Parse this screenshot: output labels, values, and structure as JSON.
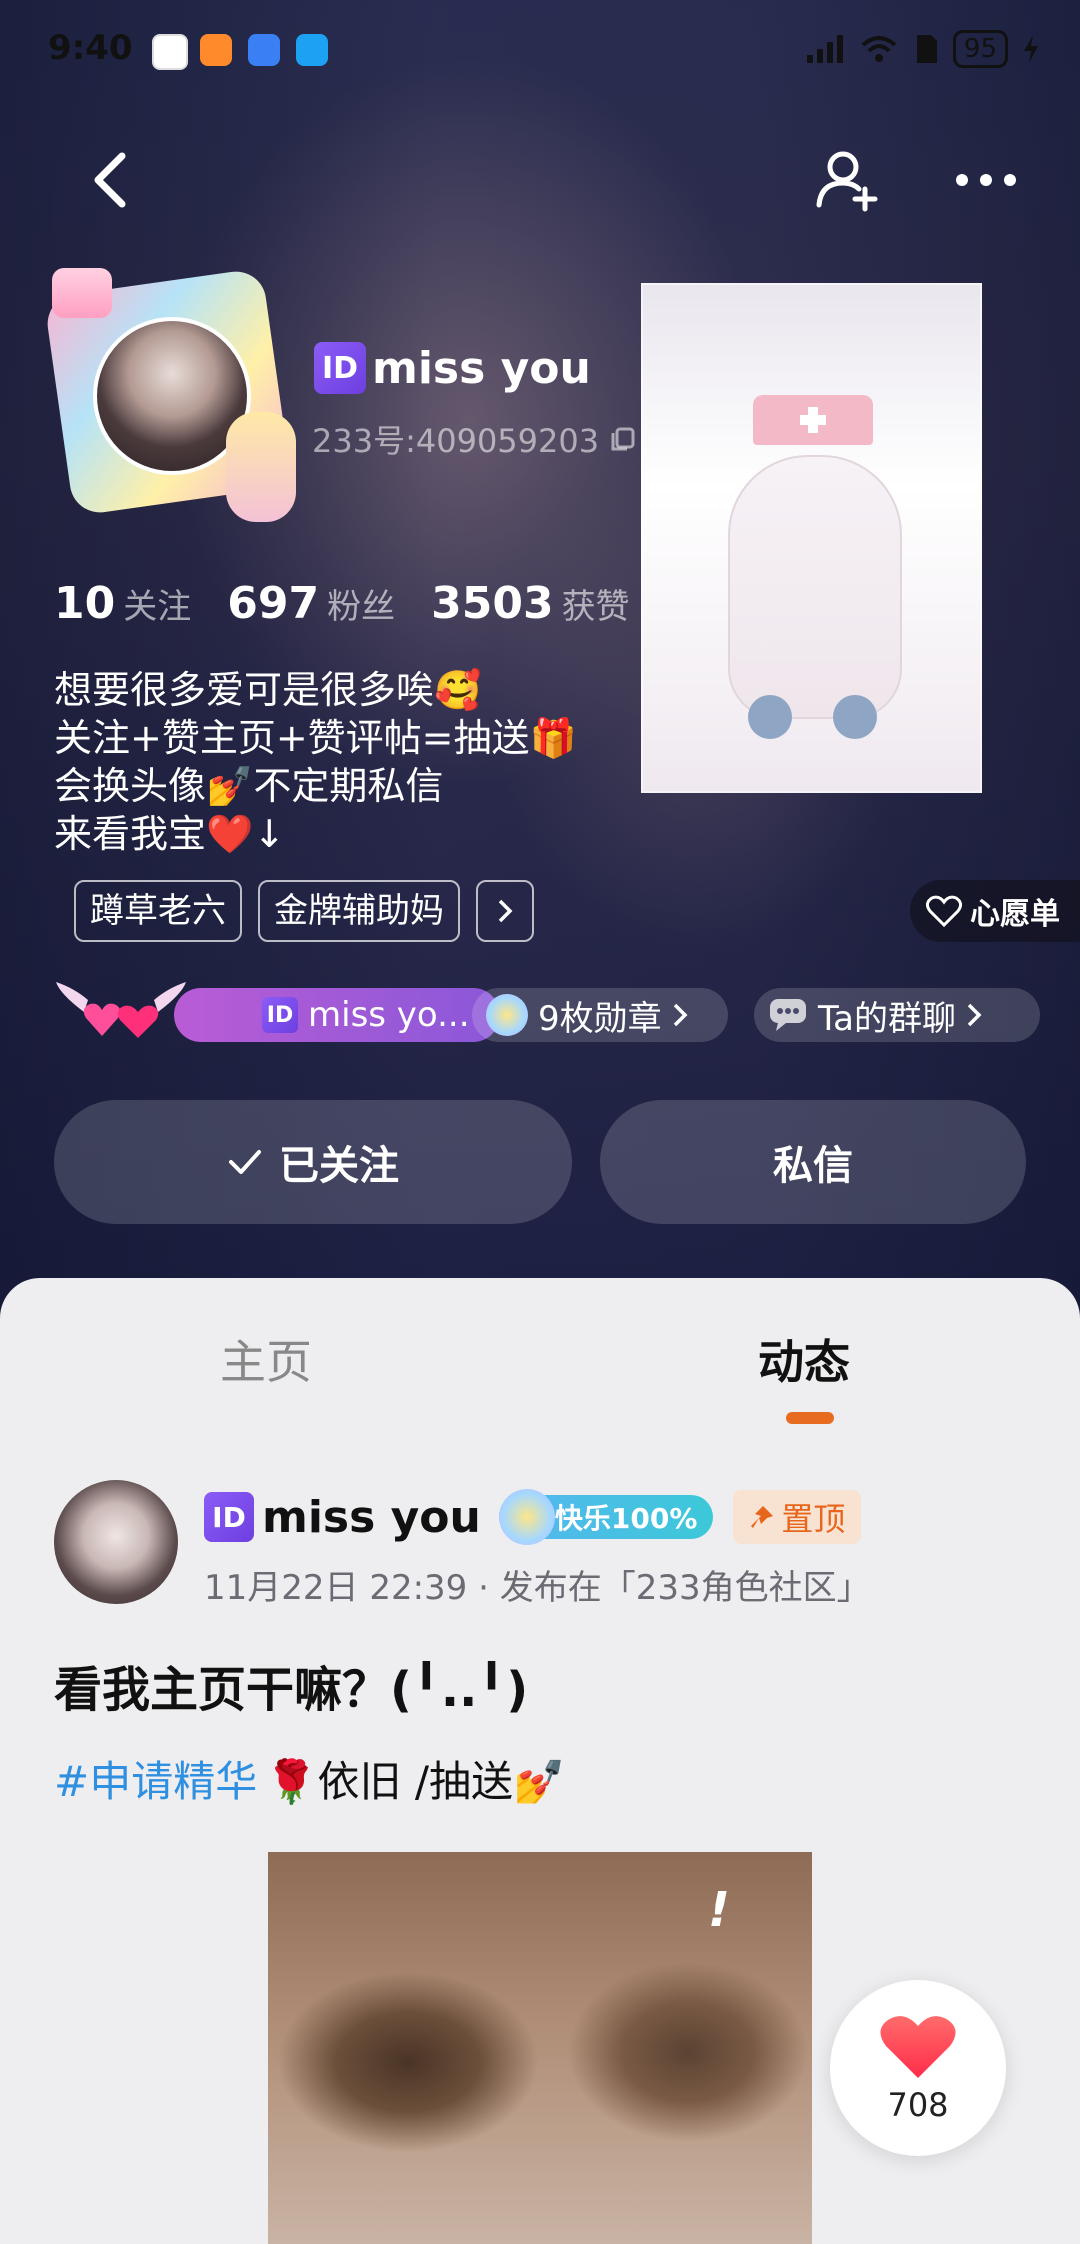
{
  "status_bar": {
    "time": "9:40",
    "battery": "95"
  },
  "profile": {
    "name": "miss you",
    "id_badge": "ID",
    "uid": "233号:409059203",
    "stats": [
      {
        "value": "10",
        "label": "关注"
      },
      {
        "value": "697",
        "label": "粉丝"
      },
      {
        "value": "3503",
        "label": "获赞"
      }
    ],
    "bio": [
      "想要很多爱可是很多唉🥰",
      "关注+赞主页+赞评帖=抽送🎁",
      "会换头像💅不定期私信",
      "来看我宝❤️↓"
    ],
    "tags": [
      "蹲草老六",
      "金牌辅助妈"
    ],
    "wishlist_label": "心愿单",
    "chip_name": "miss yo...",
    "chip_badges": "9枚勋章",
    "chip_group": "Ta的群聊",
    "follow_button": "已关注",
    "message_button": "私信"
  },
  "tabs": [
    {
      "label": "主页",
      "active": false
    },
    {
      "label": "动态",
      "active": true
    }
  ],
  "post": {
    "author": "miss you",
    "id_badge": "ID",
    "happy_badge": "快乐100%",
    "pin_label": "置顶",
    "meta": "11月22日 22:39 · 发布在「233角色社区」",
    "title": "看我主页干嘛？(╹..╹)",
    "hashtag": "#申请精华",
    "body_text": "🌹依旧 /抽送💅",
    "image_mark": "!",
    "like_count": "708"
  },
  "colors": {
    "accent_orange": "#e86c1f",
    "id_purple": "#7c4dea",
    "hashtag_blue": "#2f8fe0",
    "like_red": "#ff3b4a"
  }
}
